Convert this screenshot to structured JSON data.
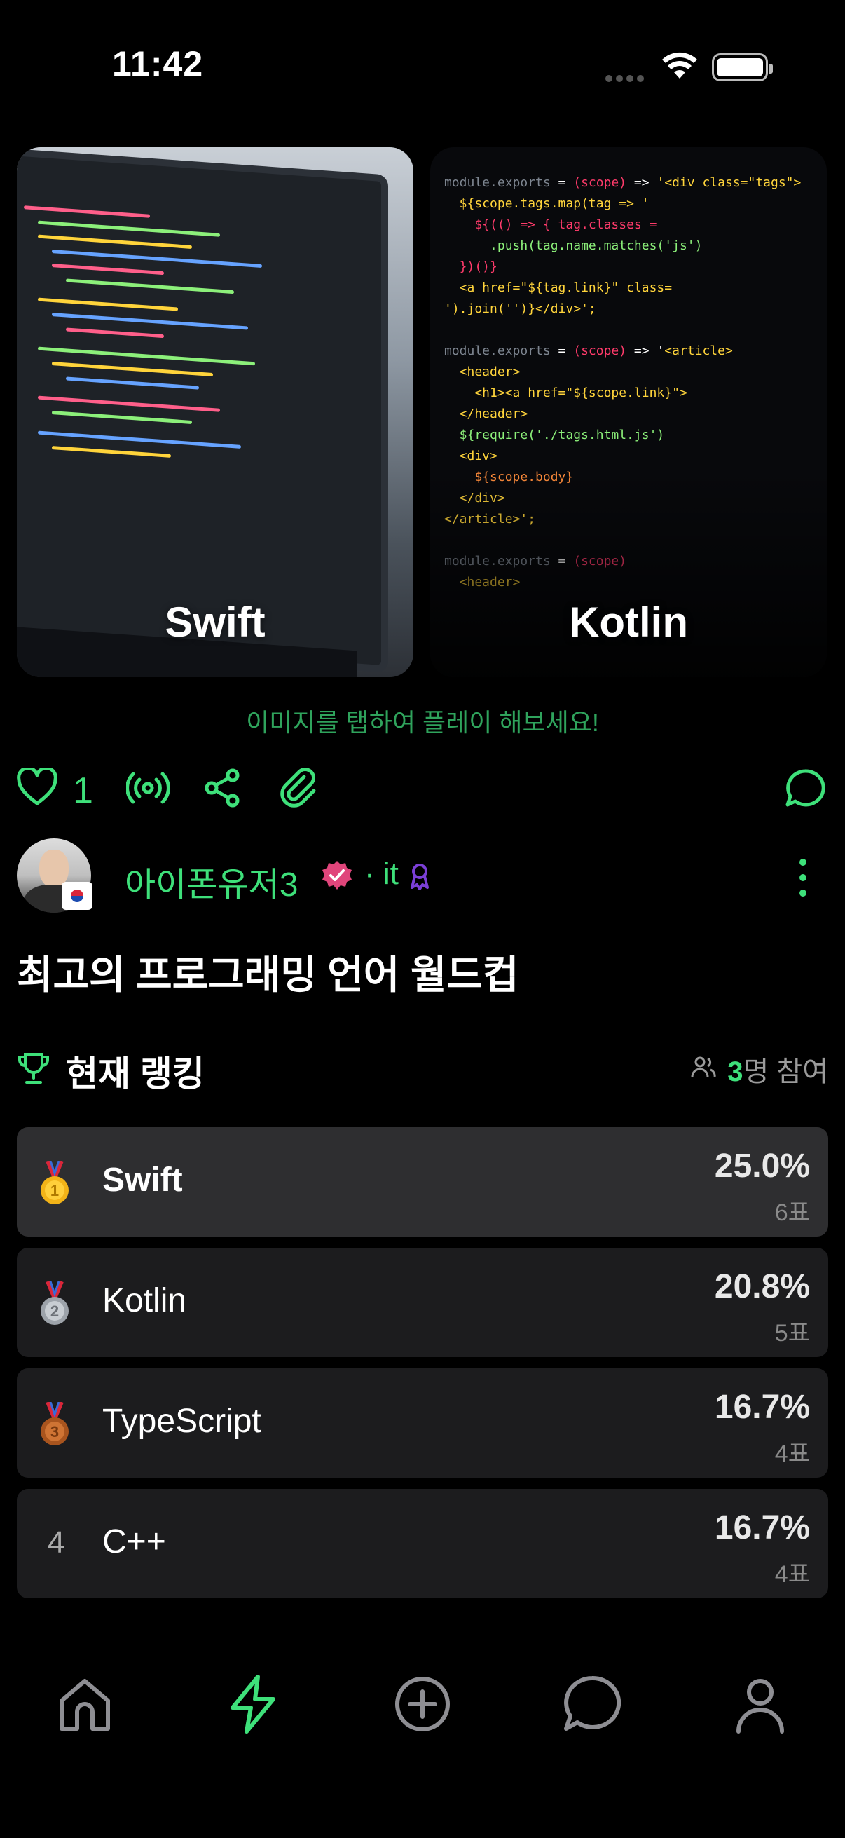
{
  "status_bar": {
    "time": "11:42"
  },
  "cards": [
    {
      "label": "Swift"
    },
    {
      "label": "Kotlin"
    }
  ],
  "hint": "이미지를 탭하여 플레이 해보세요!",
  "actions": {
    "like_count": "1"
  },
  "user": {
    "name": "아이폰유저3",
    "category": "· it"
  },
  "post_title": "최고의 프로그래밍 언어 월드컵",
  "ranking": {
    "heading": "현재 랭킹",
    "participants_count": "3",
    "participants_suffix": "명 참여",
    "items": [
      {
        "rank": "1",
        "name": "Swift",
        "percent": "25.0%",
        "votes": "6표"
      },
      {
        "rank": "2",
        "name": "Kotlin",
        "percent": "20.8%",
        "votes": "5표"
      },
      {
        "rank": "3",
        "name": "TypeScript",
        "percent": "16.7%",
        "votes": "4표"
      },
      {
        "rank": "4",
        "name": "C++",
        "percent": "16.7%",
        "votes": "4표"
      }
    ]
  },
  "colors": {
    "accent": "#3ee07a",
    "verified": "#e0457b",
    "ribbon": "#7b3fd6"
  },
  "tabbar": [
    "home-icon",
    "bolt-icon",
    "plus-circle-icon",
    "chat-icon",
    "profile-icon"
  ]
}
